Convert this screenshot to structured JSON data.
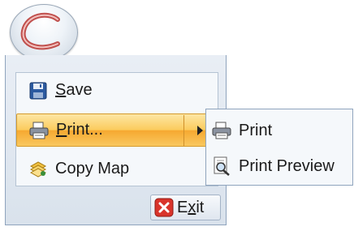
{
  "menu": {
    "items": [
      {
        "label_pre": "",
        "label_u": "S",
        "label_post": "ave",
        "icon": "floppy-disk-icon"
      },
      {
        "label_pre": "",
        "label_u": "P",
        "label_post": "rint...",
        "icon": "printer-icon"
      },
      {
        "label_pre": "",
        "label_u": "",
        "label_post": "Copy Map",
        "icon": "copy-map-icon"
      }
    ],
    "exit": {
      "label_pre": "E",
      "label_u": "x",
      "label_post": "it",
      "icon": "exit-icon"
    }
  },
  "submenu": {
    "items": [
      {
        "label": "Print",
        "icon": "printer-icon"
      },
      {
        "label": "Print Preview",
        "icon": "print-preview-icon"
      }
    ]
  },
  "colors": {
    "highlight": "#fbcb5c",
    "border": "#8fa4bd",
    "exit_red": "#d9342b"
  }
}
